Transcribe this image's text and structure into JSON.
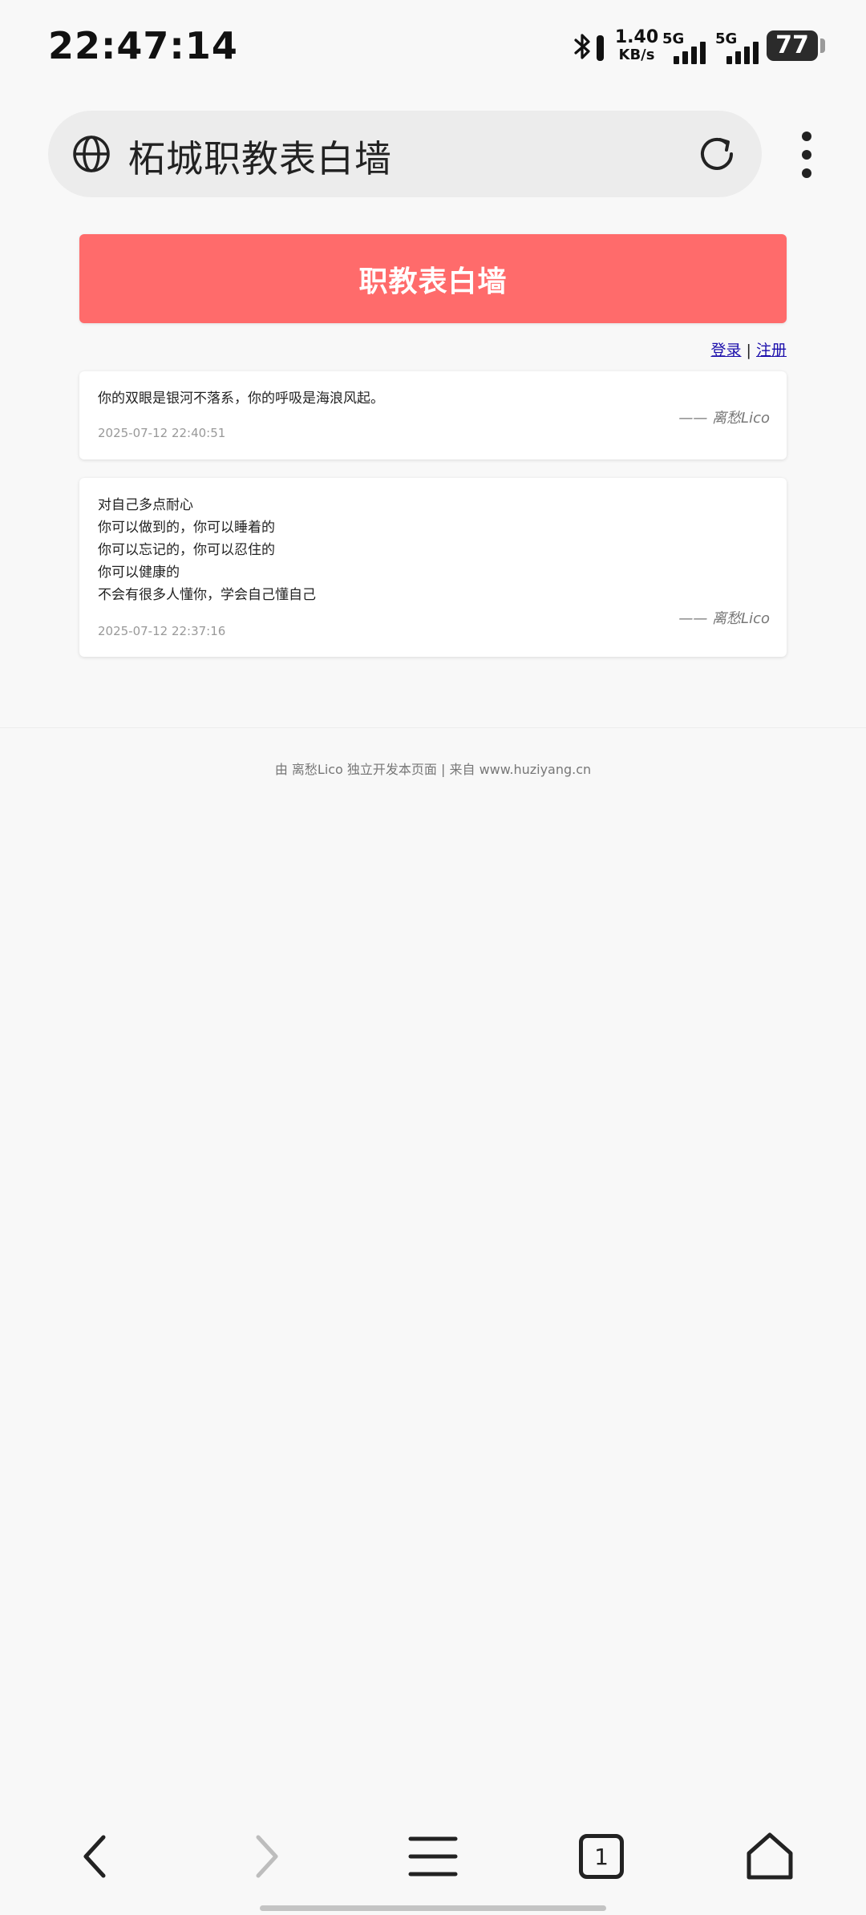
{
  "status_bar": {
    "time": "22:47:14",
    "net_speed_value": "1.40",
    "net_speed_unit": "KB/s",
    "sim1_label": "5G",
    "sim2_label": "5G",
    "battery": "77"
  },
  "browser": {
    "url_title": "柘城职教表白墙",
    "tab_count": "1"
  },
  "page": {
    "banner_title": "职教表白墙",
    "login_link": "登录",
    "separator": "|",
    "register_link": "注册",
    "posts": [
      {
        "content": "你的双眼是银河不落系，你的呼吸是海浪风起。",
        "author": "—— 离愁Lico",
        "time": "2025-07-12 22:40:51"
      },
      {
        "content": "对自己多点耐心\n你可以做到的，你可以睡着的\n你可以忘记的，你可以忍住的\n你可以健康的\n不会有很多人懂你，学会自己懂自己",
        "author": "—— 离愁Lico",
        "time": "2025-07-12 22:37:16"
      }
    ],
    "footer": "由 离愁Lico 独立开发本页面 | 来自 www.huziyang.cn"
  }
}
